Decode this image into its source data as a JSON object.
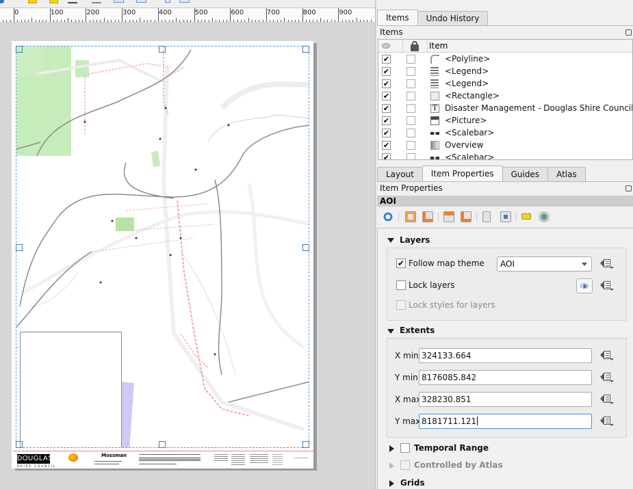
{
  "ruler": {
    "labels": [
      "0",
      "100",
      "200",
      "300",
      "400",
      "500",
      "600",
      "700",
      "800",
      "900"
    ]
  },
  "layout_page": {
    "footer": {
      "logo_text": "DOUGLAS",
      "logo_subtext": "SHIRE COUNCIL",
      "map_title": "Mossman"
    }
  },
  "items_panel": {
    "tabs": [
      {
        "label": "Items",
        "active": true
      },
      {
        "label": "Undo History",
        "active": false
      }
    ],
    "title": "Items",
    "columns": {
      "visible_icon": "eye-icon",
      "lock_icon": "lock-icon",
      "item": "Item"
    },
    "rows": [
      {
        "visible": true,
        "locked": false,
        "icon": "polyline-icon",
        "name": "<Polyline>"
      },
      {
        "visible": true,
        "locked": false,
        "icon": "legend-icon",
        "name": "<Legend>"
      },
      {
        "visible": true,
        "locked": false,
        "icon": "legend-icon",
        "name": "<Legend>"
      },
      {
        "visible": true,
        "locked": false,
        "icon": "rectangle-icon",
        "name": "<Rectangle>"
      },
      {
        "visible": true,
        "locked": false,
        "icon": "label-icon",
        "name": "Disaster Management - Douglas Shire Council"
      },
      {
        "visible": true,
        "locked": false,
        "icon": "picture-icon",
        "name": "<Picture>"
      },
      {
        "visible": true,
        "locked": false,
        "icon": "scalebar-icon",
        "name": "<Scalebar>"
      },
      {
        "visible": true,
        "locked": false,
        "icon": "map-icon",
        "name": "Overview"
      },
      {
        "visible": true,
        "locked": false,
        "icon": "scalebar-icon",
        "name": "<Scalebar>"
      }
    ]
  },
  "properties_panel": {
    "tabs": [
      {
        "label": "Layout",
        "active": false
      },
      {
        "label": "Item Properties",
        "active": true
      },
      {
        "label": "Guides",
        "active": false
      },
      {
        "label": "Atlas",
        "active": false
      }
    ],
    "title": "Item Properties",
    "item_name": "AOI",
    "toolbar_icons": [
      "refresh-icon",
      "set-extent-icon",
      "view-extent-icon",
      "set-scale-icon",
      "view-scale-icon",
      "bookmark-icon",
      "move-content-icon",
      "labeling-icon",
      "clipping-icon"
    ],
    "layers": {
      "heading": "Layers",
      "follow_map_theme": {
        "label": "Follow map theme",
        "checked": true
      },
      "map_theme_value": "AOI",
      "lock_layers": {
        "label": "Lock layers",
        "checked": false
      },
      "lock_styles": {
        "label": "Lock styles for layers",
        "checked": false,
        "enabled": false
      }
    },
    "extents": {
      "heading": "Extents",
      "fields": [
        {
          "label": "X min",
          "value": "324133.664"
        },
        {
          "label": "Y min",
          "value": "8176085.842"
        },
        {
          "label": "X max",
          "value": "328230.851"
        },
        {
          "label": "Y max",
          "value": "8181711.121"
        }
      ]
    },
    "collapsed_sections": [
      {
        "label": "Temporal Range",
        "has_checkbox": true,
        "checked": false,
        "enabled": true
      },
      {
        "label": "Controlled by Atlas",
        "has_checkbox": true,
        "checked": false,
        "enabled": false
      },
      {
        "label": "Grids",
        "has_checkbox": false,
        "enabled": true
      }
    ]
  }
}
